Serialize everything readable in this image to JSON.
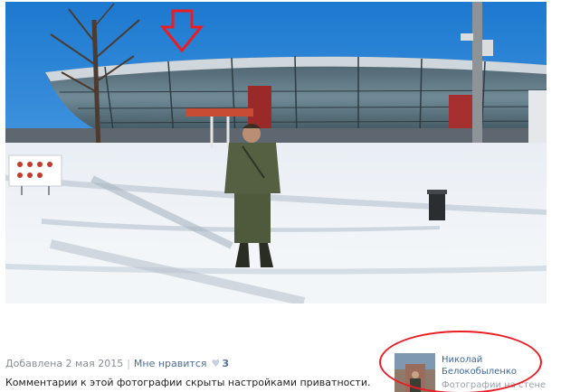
{
  "post": {
    "added": "Добавлена 2 мая 2015",
    "like_label": "Мне нравится",
    "like_count": "3",
    "comments_note": "Комментарии к этой фотографии скрыты настройками приватности."
  },
  "author": {
    "name": "Николай Белокобыленко",
    "caption": "Фотографии на стене"
  },
  "icons": {
    "like": "heart-icon",
    "annotation": "arrow-down-icon"
  },
  "colors": {
    "annotation_red": "#ea1d25",
    "link_blue": "#3f6899",
    "meta_gray": "#8a8f95"
  }
}
